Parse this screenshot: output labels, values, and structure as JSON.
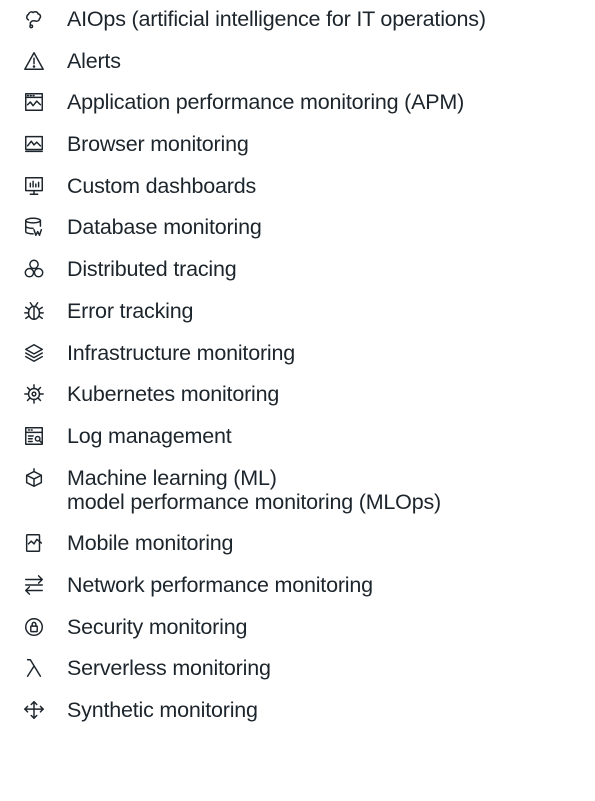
{
  "items": [
    {
      "label": "AIOps  (artificial intelligence for IT operations)",
      "icon": "ai-brain-icon"
    },
    {
      "label": "Alerts",
      "icon": "alert-triangle-icon"
    },
    {
      "label": "Application performance monitoring (APM)",
      "icon": "apm-window-chart-icon"
    },
    {
      "label": "Browser monitoring",
      "icon": "browser-chart-icon"
    },
    {
      "label": "Custom dashboards",
      "icon": "dashboard-monitor-icon"
    },
    {
      "label": "Database monitoring",
      "icon": "database-icon"
    },
    {
      "label": "Distributed tracing",
      "icon": "distributed-nodes-icon"
    },
    {
      "label": "Error tracking",
      "icon": "bug-icon"
    },
    {
      "label": "Infrastructure monitoring",
      "icon": "layers-icon"
    },
    {
      "label": "Kubernetes monitoring",
      "icon": "kubernetes-wheel-icon"
    },
    {
      "label": "Log management",
      "icon": "log-search-icon"
    },
    {
      "label_line1": "Machine learning (ML)",
      "label_line2": "model performance monitoring (MLOps)",
      "icon": "ml-cube-icon"
    },
    {
      "label": "Mobile monitoring",
      "icon": "mobile-chart-icon"
    },
    {
      "label": "Network performance monitoring",
      "icon": "network-arrows-icon"
    },
    {
      "label": "Security monitoring",
      "icon": "security-shield-icon"
    },
    {
      "label": "Serverless monitoring",
      "icon": "lambda-icon"
    },
    {
      "label": "Synthetic monitoring",
      "icon": "synthetic-arrows-icon"
    }
  ]
}
